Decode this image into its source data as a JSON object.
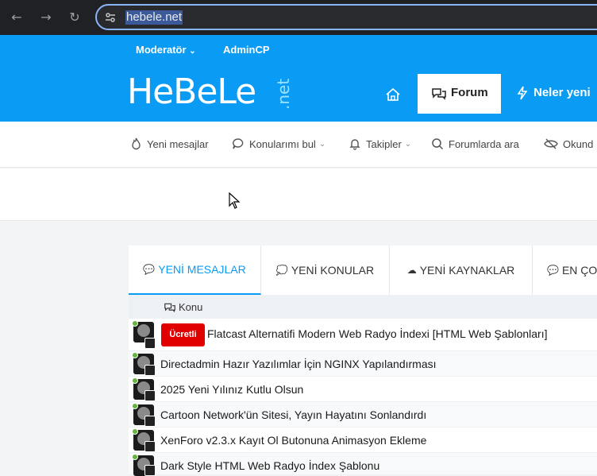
{
  "browser": {
    "url": "hebele.net"
  },
  "topnav": {
    "moderator": "Moderatör",
    "admincp": "AdminCP"
  },
  "logo": {
    "main": "HeBeLe",
    "suffix": ".net"
  },
  "mainnav": {
    "forum": "Forum",
    "whats_new": "Neler yeni"
  },
  "subnav": {
    "items": [
      {
        "label": "Yeni mesajlar",
        "icon": "flame-icon"
      },
      {
        "label": "Konularımı bul",
        "icon": "chat-bubble-icon"
      },
      {
        "label": "Takipler",
        "icon": "bell-icon"
      },
      {
        "label": "Forumlarda ara",
        "icon": "search-icon"
      },
      {
        "label": "Okund",
        "icon": "eye-slash-icon"
      }
    ]
  },
  "tabs": [
    {
      "label": "YENİ MESAJLAR",
      "icon": "💬",
      "active": true
    },
    {
      "label": "YENİ KONULAR",
      "icon": "💭",
      "active": false
    },
    {
      "label": "YENİ KAYNAKLAR",
      "icon": "☁",
      "active": false
    },
    {
      "label": "EN ÇO",
      "icon": "💬",
      "active": false
    }
  ],
  "table": {
    "header": "Konu",
    "rows": [
      {
        "badge": "Ücretli",
        "title": "Flatcast Alternatifi Modern Web Radyo İndexi [HTML Web Şablonları]"
      },
      {
        "badge": "",
        "title": "Directadmin Hazır Yazılımlar İçin NGINX Yapılandırması"
      },
      {
        "badge": "",
        "title": "2025 Yeni Yılınız Kutlu Olsun"
      },
      {
        "badge": "",
        "title": "Cartoon Network'ün Sitesi, Yayın Hayatını Sonlandırdı"
      },
      {
        "badge": "",
        "title": "XenForo v2.3.x Kayıt Ol Butonuna Animasyon Ekleme"
      },
      {
        "badge": "",
        "title": "Dark Style HTML Web Radyo İndex Şablonu"
      }
    ]
  },
  "colors": {
    "brand": "#0a9bf5",
    "badge": "#e00000",
    "online": "#63b33d"
  }
}
